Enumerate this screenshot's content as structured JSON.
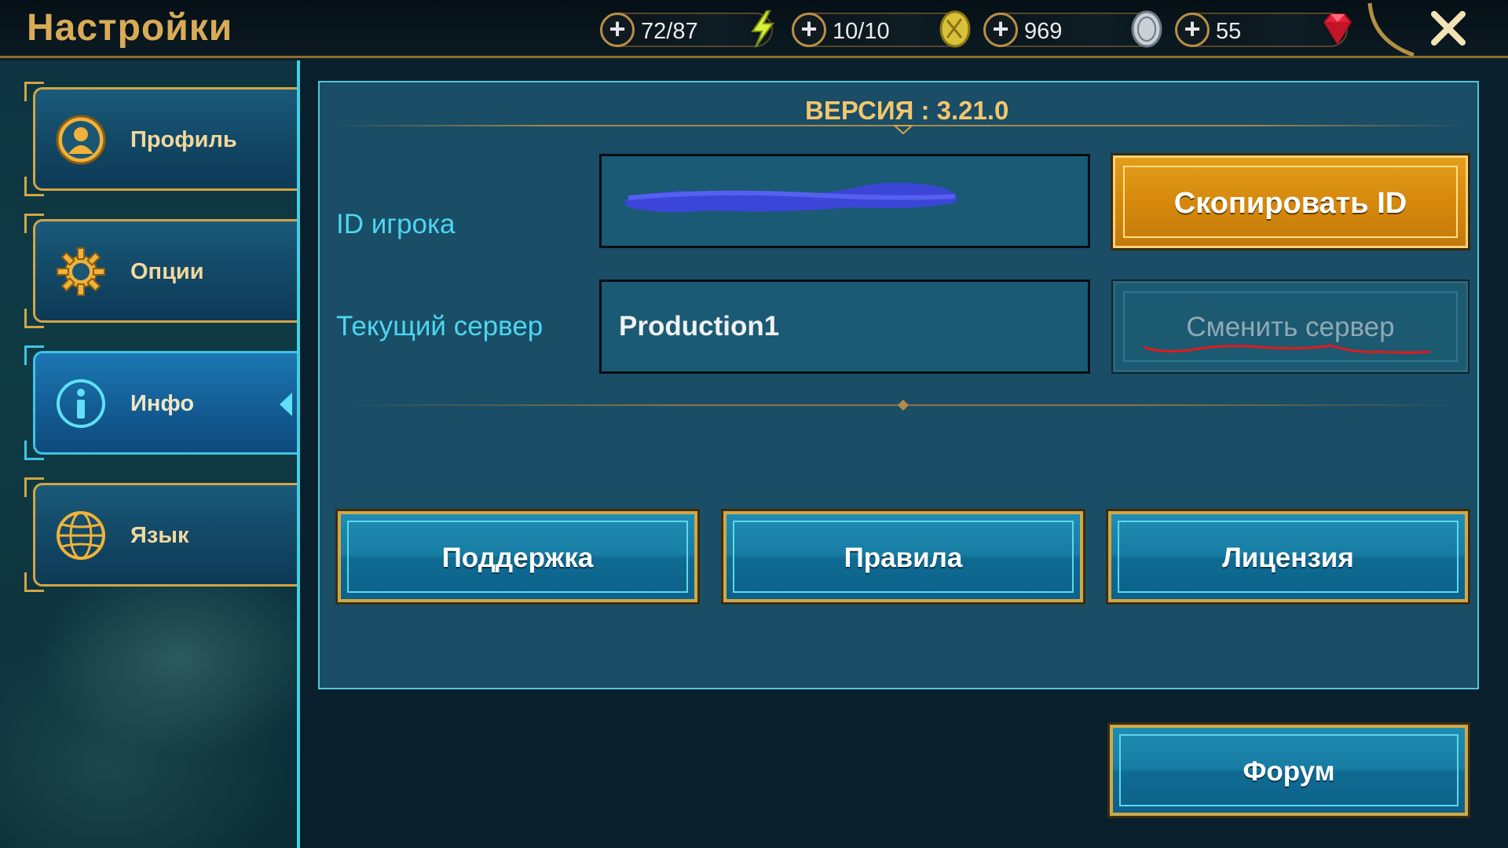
{
  "header": {
    "title": "Настройки",
    "currencies": [
      {
        "value": "72/87",
        "icon": "energy-lightning-icon"
      },
      {
        "value": "10/10",
        "icon": "arena-token-icon"
      },
      {
        "value": "969",
        "icon": "silver-coin-icon"
      },
      {
        "value": "55",
        "icon": "ruby-gem-icon"
      }
    ],
    "close_icon": "close-icon"
  },
  "sidebar": {
    "items": [
      {
        "label": "Профиль",
        "icon": "profile-icon",
        "active": false
      },
      {
        "label": "Опции",
        "icon": "gear-icon",
        "active": false
      },
      {
        "label": "Инфо",
        "icon": "info-icon",
        "active": true
      },
      {
        "label": "Язык",
        "icon": "globe-icon",
        "active": false
      }
    ]
  },
  "main": {
    "version_label": "ВЕРСИЯ : 3.21.0",
    "player_id": {
      "label": "ID игрока",
      "value": ""
    },
    "server": {
      "label": "Текущий сервер",
      "value": "Production1"
    },
    "copy_id_button": "Скопировать ID",
    "change_server_button": "Сменить сервер",
    "links": [
      "Поддержка",
      "Правила",
      "Лицензия"
    ],
    "forum_button": "Форум"
  },
  "colors": {
    "gold_accent": "#d2a546",
    "cyan_accent": "#4fc6dc",
    "title_gold": "#d9ab58",
    "label_cyan": "#4dd6f0",
    "copy_button": "#d6890d"
  }
}
